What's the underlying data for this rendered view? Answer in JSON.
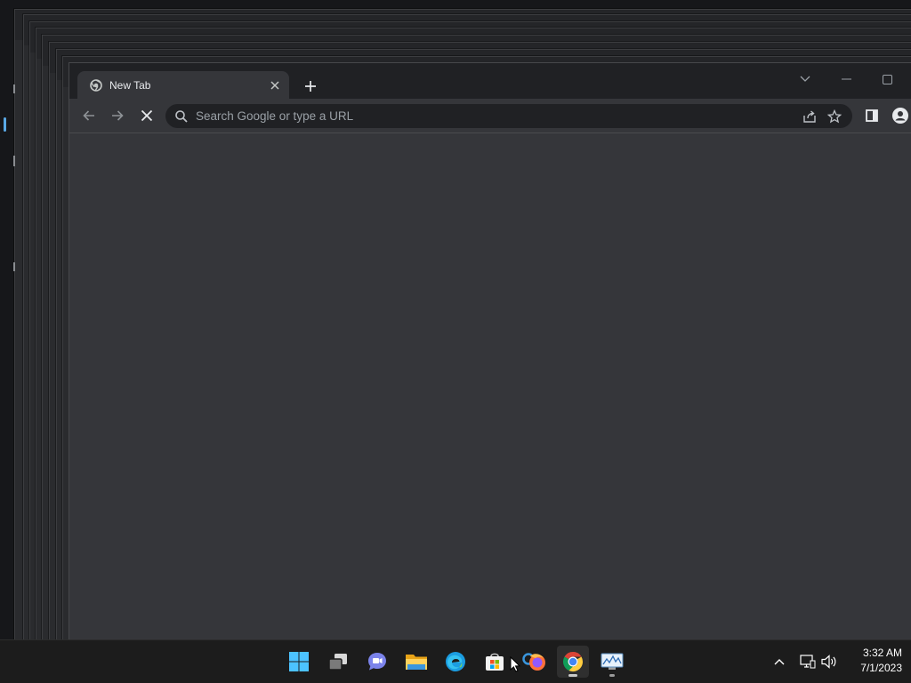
{
  "browser": {
    "tab": {
      "title": "New Tab",
      "favicon": "chrome-newtab-icon",
      "close_icon": "close-icon"
    },
    "new_tab_icon": "plus-icon",
    "window_controls": [
      "chevron-down-icon",
      "minimize-icon",
      "maximize-icon"
    ],
    "toolbar": {
      "back_icon": "arrow-left-icon",
      "forward_icon": "arrow-right-icon",
      "stop_icon": "close-icon",
      "omnibox": {
        "placeholder": "Search Google or type a URL",
        "value": ""
      },
      "actions": [
        "share-icon",
        "star-icon",
        "side-panel-icon",
        "profile-icon"
      ]
    }
  },
  "taskbar": {
    "apps": [
      {
        "name": "Start",
        "icon": "windows-start-icon"
      },
      {
        "name": "Task View",
        "icon": "task-view-icon"
      },
      {
        "name": "Chat",
        "icon": "chat-icon"
      },
      {
        "name": "File Explorer",
        "icon": "folder-icon"
      },
      {
        "name": "Microsoft Edge",
        "icon": "edge-icon"
      },
      {
        "name": "Microsoft Store",
        "icon": "store-icon"
      },
      {
        "name": "Firefox",
        "icon": "firefox-icon"
      },
      {
        "name": "Google Chrome",
        "icon": "chrome-icon",
        "active": true
      },
      {
        "name": "Performance Monitor",
        "icon": "monitor-icon"
      }
    ],
    "tray": {
      "icons": [
        "chevron-up-icon",
        "network-icon",
        "volume-icon"
      ],
      "time": "3:32 AM",
      "date": "7/1/2023"
    }
  },
  "colors": {
    "window_bg": "#202124",
    "toolbar_bg": "#35363a",
    "taskbar_bg": "#1c1c1c",
    "accent": "#5aa9e6"
  }
}
